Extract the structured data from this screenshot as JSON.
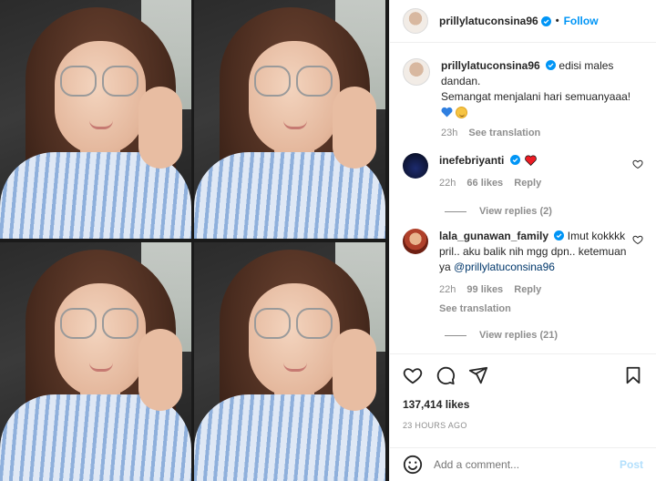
{
  "header": {
    "username": "prillylatuconsina96",
    "separator": "•",
    "follow_label": "Follow"
  },
  "caption": {
    "username": "prillylatuconsina96",
    "line1": "edisi males dandan.",
    "line2": "Semangat menjalani hari semuanyaaa!",
    "time": "23h",
    "see_translation": "See translation"
  },
  "comments": [
    {
      "username": "inefebriyanti",
      "time": "22h",
      "likes": "66 likes",
      "reply": "Reply",
      "view_replies": "View replies (2)"
    },
    {
      "username": "lala_gunawan_family",
      "text": "Imut kokkkk pril.. aku balik nih mgg dpn.. ketemuan ya",
      "mention": "@prillylatuconsina96",
      "time": "22h",
      "likes": "99 likes",
      "reply": "Reply",
      "see_translation": "See translation",
      "view_replies": "View replies (21)"
    }
  ],
  "post": {
    "likes": "137,414 likes",
    "timestamp": "23 HOURS AGO"
  },
  "add_comment": {
    "placeholder": "Add a comment...",
    "post_label": "Post"
  },
  "icons": {
    "like": "heart-icon",
    "comment": "comment-icon",
    "share": "share-icon",
    "save": "bookmark-icon",
    "emoji": "emoji-icon",
    "verified": "verified-badge-icon"
  },
  "colors": {
    "accent": "#0095f6",
    "mention": "#00376b",
    "muted": "#8e8e8e",
    "post_disabled": "#b2dffc",
    "heart_red": "#ed4956"
  }
}
